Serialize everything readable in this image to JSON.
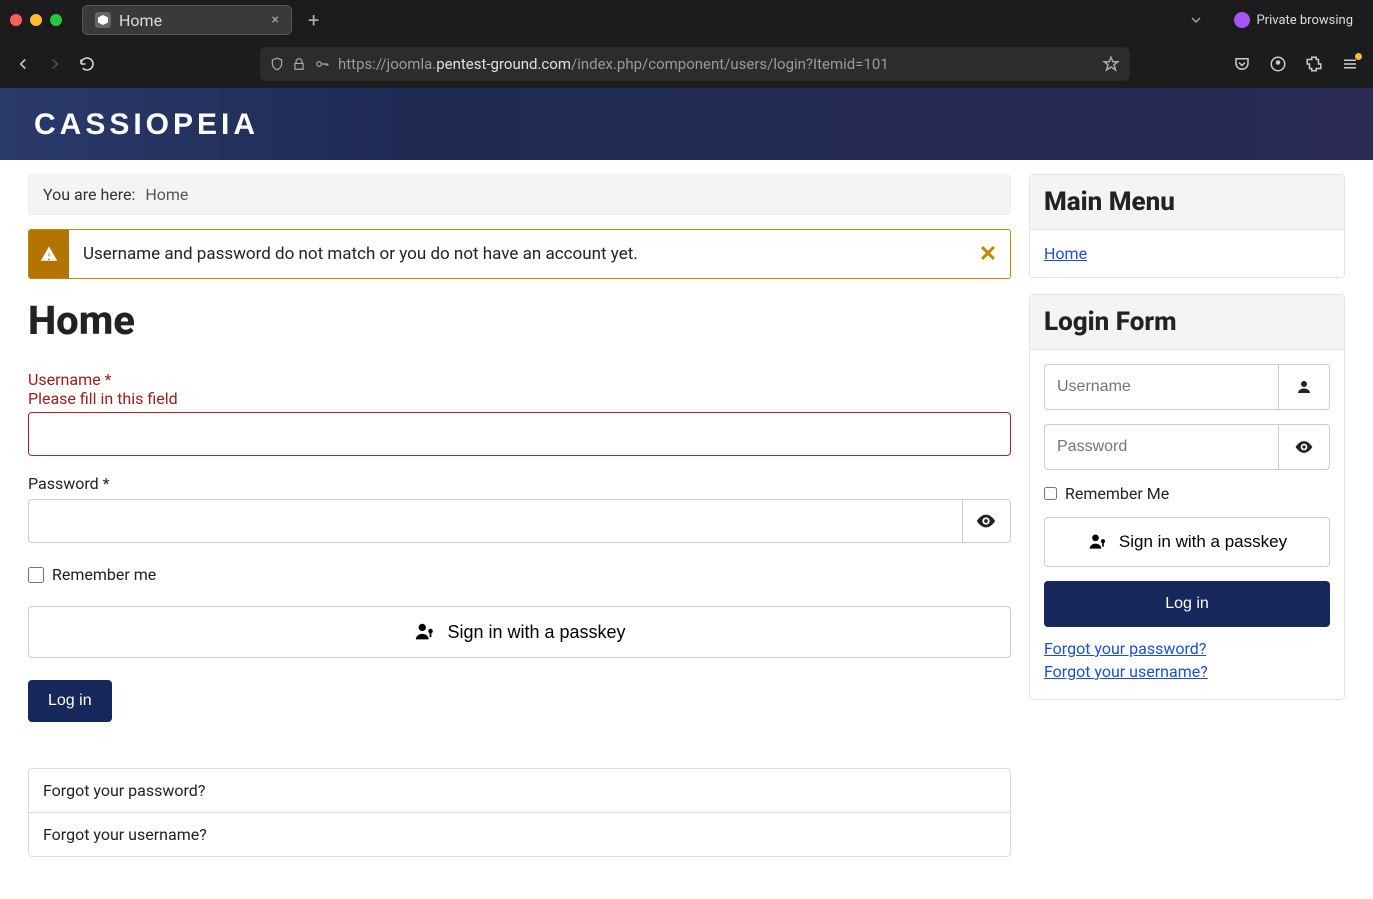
{
  "browser": {
    "tab_title": "Home",
    "private_label": "Private browsing",
    "url_plain_pre": "https://joomla.",
    "url_bold": "pentest-ground.com",
    "url_plain_post": "/index.php/component/users/login?Itemid=101"
  },
  "site": {
    "brand": "CASSIOPEIA"
  },
  "breadcrumb": {
    "prefix": "You are here:",
    "current": "Home"
  },
  "alert": {
    "message": "Username and password do not match or you do not have an account yet."
  },
  "page_title": "Home",
  "form": {
    "username_label": "Username *",
    "username_hint": "Please fill in this field",
    "username_value": "",
    "password_label": "Password *",
    "password_value": "",
    "remember_label": "Remember me",
    "passkey_label": "Sign in with a passkey",
    "login_label": "Log in",
    "forgot_password": "Forgot your password?",
    "forgot_username": "Forgot your username?"
  },
  "sidebar": {
    "main_menu_title": "Main Menu",
    "main_menu_home": "Home",
    "login_form_title": "Login Form",
    "username_placeholder": "Username",
    "password_placeholder": "Password",
    "remember_label": "Remember Me",
    "passkey_label": "Sign in with a passkey",
    "login_label": "Log in",
    "forgot_password": "Forgot your password?",
    "forgot_username": "Forgot your username?"
  }
}
